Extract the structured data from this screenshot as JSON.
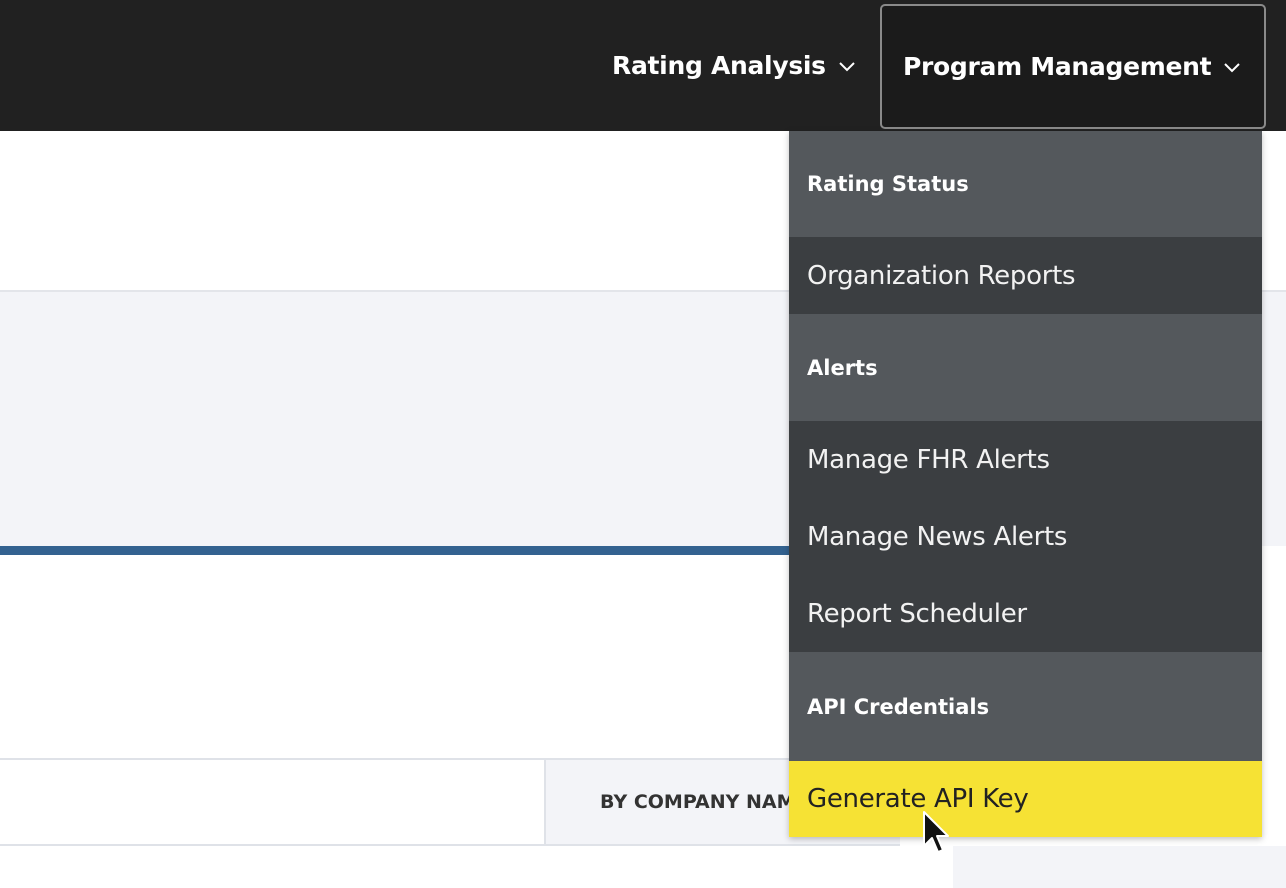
{
  "nav": {
    "rating_analysis": "Rating Analysis",
    "program_management": "Program Management"
  },
  "search": {
    "by_label": "BY COMPANY NAME"
  },
  "dropdown": {
    "groups": [
      {
        "title": "Rating Status",
        "items": [
          "Organization Reports"
        ]
      },
      {
        "title": "Alerts",
        "items": [
          "Manage FHR Alerts",
          "Manage News Alerts",
          "Report Scheduler"
        ]
      },
      {
        "title": "API Credentials",
        "items": [
          "Generate API Key"
        ]
      }
    ],
    "active_item": "Generate API Key"
  },
  "colors": {
    "topbar": "#212121",
    "menu_group": "#54585c",
    "menu_item": "#3b3e41",
    "highlight": "#f6e234",
    "accent_rule": "#336290"
  }
}
